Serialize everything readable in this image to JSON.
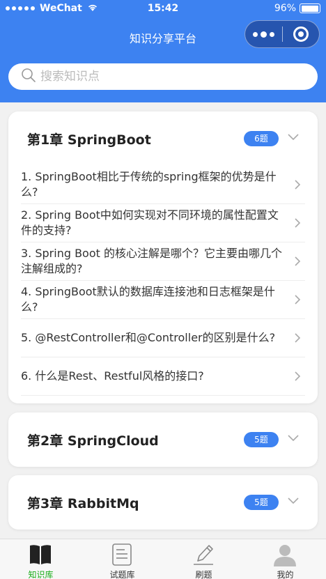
{
  "status_bar": {
    "carrier": "WeChat",
    "time": "15:42",
    "battery": "96%",
    "battery_level": 0.96
  },
  "nav": {
    "title": "知识分享平台"
  },
  "search": {
    "placeholder": "搜索知识点"
  },
  "chapters": [
    {
      "title": "第1章 SpringBoot",
      "count": "6题",
      "questions": [
        "1. SpringBoot相比于传统的spring框架的优势是什么?",
        "2. Spring Boot中如何实现对不同环境的属性配置文件的支持?",
        "3. Spring Boot 的核心注解是哪个？它主要由哪几个注解组成的?",
        "4. SpringBoot默认的数据库连接池和日志框架是什么?",
        "5. @RestController和@Controller的区别是什么?",
        "6. 什么是Rest、Restful风格的接口?"
      ]
    },
    {
      "title": "第2章 SpringCloud",
      "count": "5题"
    },
    {
      "title": "第3章 RabbitMq",
      "count": "5题"
    }
  ],
  "tabs": [
    {
      "label": "知识库",
      "active": true
    },
    {
      "label": "试题库",
      "active": false
    },
    {
      "label": "刷题",
      "active": false
    },
    {
      "label": "我的",
      "active": false
    }
  ],
  "colors": {
    "primary": "#3d82f1",
    "active_tab": "#1aad19"
  }
}
